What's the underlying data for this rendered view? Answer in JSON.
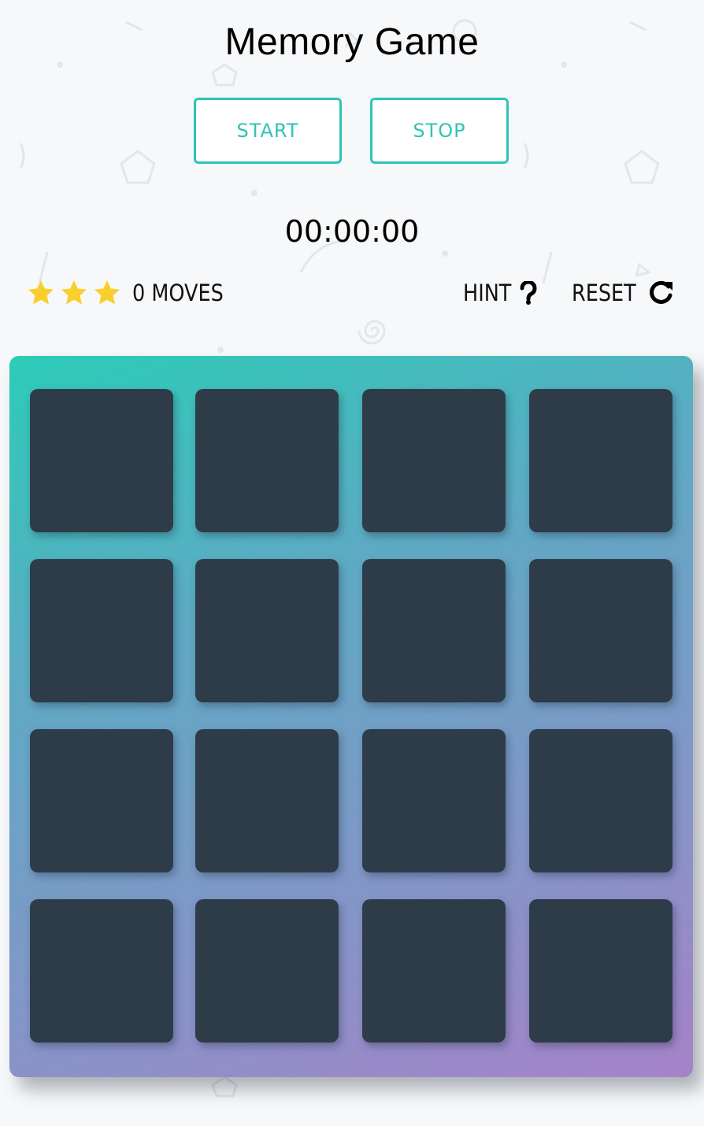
{
  "title": "Memory Game",
  "controls": {
    "start_label": "START",
    "stop_label": "STOP"
  },
  "timer": "00:00:00",
  "score": {
    "stars": 3,
    "moves_label": "0 MOVES"
  },
  "actions": {
    "hint_label": "HINT",
    "hint_icon": "question-mark-icon",
    "reset_label": "RESET",
    "reset_icon": "refresh-icon"
  },
  "deck": {
    "rows": 4,
    "cols": 4,
    "cards": [
      "hidden",
      "hidden",
      "hidden",
      "hidden",
      "hidden",
      "hidden",
      "hidden",
      "hidden",
      "hidden",
      "hidden",
      "hidden",
      "hidden",
      "hidden",
      "hidden",
      "hidden",
      "hidden"
    ]
  },
  "colors": {
    "accent": "#2ec4b6",
    "card_back": "#2e3c49",
    "star": "#f9cf2e",
    "board_gradient_start": "#2cccb8",
    "board_gradient_end": "#a682c9"
  }
}
